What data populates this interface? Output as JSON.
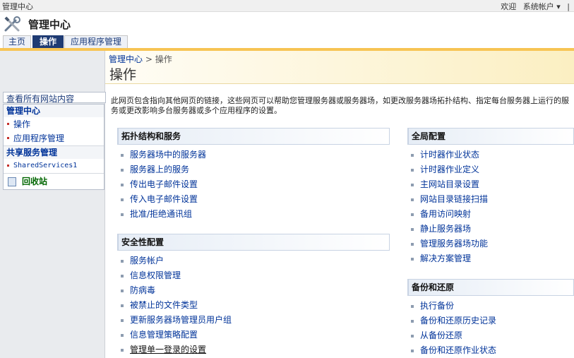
{
  "topbar": {
    "site_title": "管理中心",
    "welcome": "欢迎",
    "account": "系统帐户 ▾",
    "separator": "|"
  },
  "header": {
    "app_title": "管理中心"
  },
  "tabs": [
    {
      "label": "主页",
      "active": false
    },
    {
      "label": "操作",
      "active": true
    },
    {
      "label": "应用程序管理",
      "active": false
    }
  ],
  "leftnav": {
    "view_all": "查看所有网站内容",
    "groups": [
      {
        "title": "管理中心",
        "items": [
          "操作",
          "应用程序管理"
        ]
      },
      {
        "title": "共享服务管理",
        "items": [
          "SharedServices1"
        ]
      }
    ],
    "recycle_bin": "回收站"
  },
  "breadcrumb": {
    "root": "管理中心",
    "separator": ">",
    "current": "操作"
  },
  "page_title": "操作",
  "description": "此网页包含指向其他网页的链接，这些网页可以帮助您管理服务器或服务器场，如更改服务器场拓扑结构、指定每台服务器上运行的服务或更改影响多台服务器或多个应用程序的设置。",
  "sections": {
    "topology": {
      "title": "拓扑结构和服务",
      "links": [
        "服务器场中的服务器",
        "服务器上的服务",
        "传出电子邮件设置",
        "传入电子邮件设置",
        "批准/拒绝通讯组"
      ]
    },
    "security": {
      "title": "安全性配置",
      "links": [
        "服务帐户",
        "信息权限管理",
        "防病毒",
        "被禁止的文件类型",
        "更新服务器场管理员用户组",
        "信息管理策略配置",
        "管理单一登录的设置"
      ]
    },
    "global": {
      "title": "全局配置",
      "links": [
        "计时器作业状态",
        "计时器作业定义",
        "主网站目录设置",
        "网站目录链接扫描",
        "备用访问映射",
        "静止服务器场",
        "管理服务器场功能",
        "解决方案管理"
      ]
    },
    "backup": {
      "title": "备份和还原",
      "links": [
        "执行备份",
        "备份和还原历史记录",
        "从备份还原",
        "备份和还原作业状态"
      ]
    }
  },
  "colors": {
    "tab_active": "#1f3b73",
    "tab_underline": "#f7c453",
    "link": "#003399",
    "nav_bullet": "#c4302b"
  },
  "icons": {
    "app": "tools-icon",
    "recycle": "recycle-bin-icon"
  }
}
